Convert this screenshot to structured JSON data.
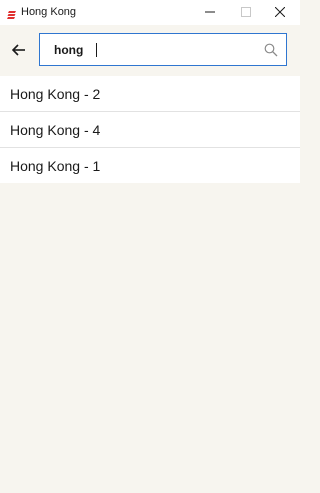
{
  "window": {
    "title": "Hong Kong",
    "logo_icon": "app-logo-icon",
    "accent": "#e0302f",
    "controls": [
      "minimize-icon",
      "maximize-icon",
      "close-icon"
    ]
  },
  "search": {
    "value": "hong",
    "placeholder": "",
    "border_color": "#2f76d0",
    "back_icon": "arrow-left-icon",
    "search_icon": "search-icon"
  },
  "results": [
    {
      "label": "Hong Kong - 2"
    },
    {
      "label": "Hong Kong - 4"
    },
    {
      "label": "Hong Kong - 1"
    }
  ],
  "colors": {
    "background": "#f7f5ef",
    "surface": "#ffffff"
  }
}
